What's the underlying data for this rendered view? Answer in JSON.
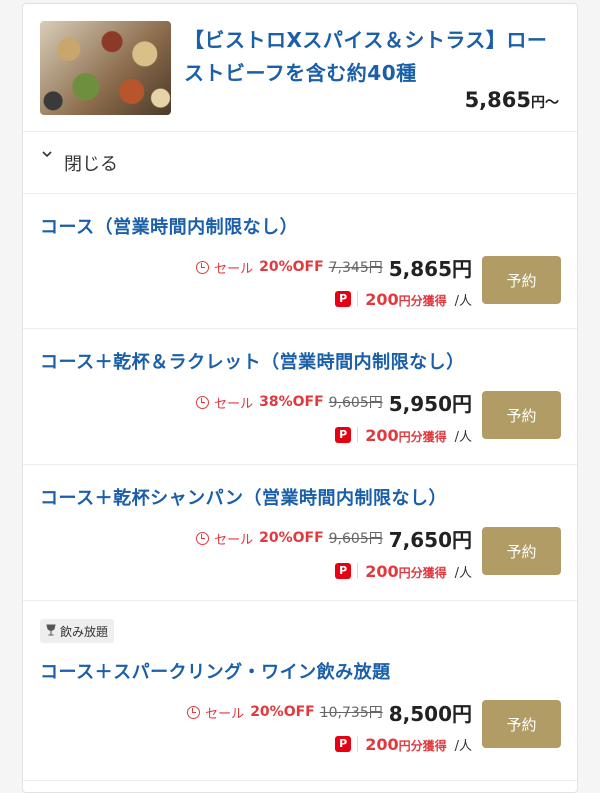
{
  "plan": {
    "title": "【ビストロXスパイス＆シトラス】ローストビーフを含む約40種",
    "price": "5,865",
    "price_suffix": "円〜"
  },
  "collapse": {
    "chevron": "chevron-down-icon",
    "label": "閉じる"
  },
  "courses": [
    {
      "name": "コース（営業時間内制限なし）",
      "sale_label": "セール",
      "discount": "20%OFF",
      "original_price": "7,345円",
      "price": "5,865円",
      "points": "200",
      "points_unit": "円分獲得",
      "per": "/人",
      "button": "予約"
    },
    {
      "name": "コース＋乾杯＆ラクレット（営業時間内制限なし）",
      "sale_label": "セール",
      "discount": "38%OFF",
      "original_price": "9,605円",
      "price": "5,950円",
      "points": "200",
      "points_unit": "円分獲得",
      "per": "/人",
      "button": "予約"
    },
    {
      "name": "コース＋乾杯シャンパン（営業時間内制限なし）",
      "sale_label": "セール",
      "discount": "20%OFF",
      "original_price": "9,605円",
      "price": "7,650円",
      "points": "200",
      "points_unit": "円分獲得",
      "per": "/人",
      "button": "予約"
    },
    {
      "tag": "飲み放題",
      "name": "コース＋スパークリング・ワイン飲み放題",
      "sale_label": "セール",
      "discount": "20%OFF",
      "original_price": "10,735円",
      "price": "8,500円",
      "points": "200",
      "points_unit": "円分獲得",
      "per": "/人",
      "button": "予約"
    }
  ],
  "payment_icon": {
    "name": "paypay-icon",
    "glyph": "P",
    "color": "#e60012"
  },
  "colors": {
    "accent_blue": "#1a5fa8",
    "sale_red": "#e0393e",
    "button_gold": "#b19c65"
  }
}
